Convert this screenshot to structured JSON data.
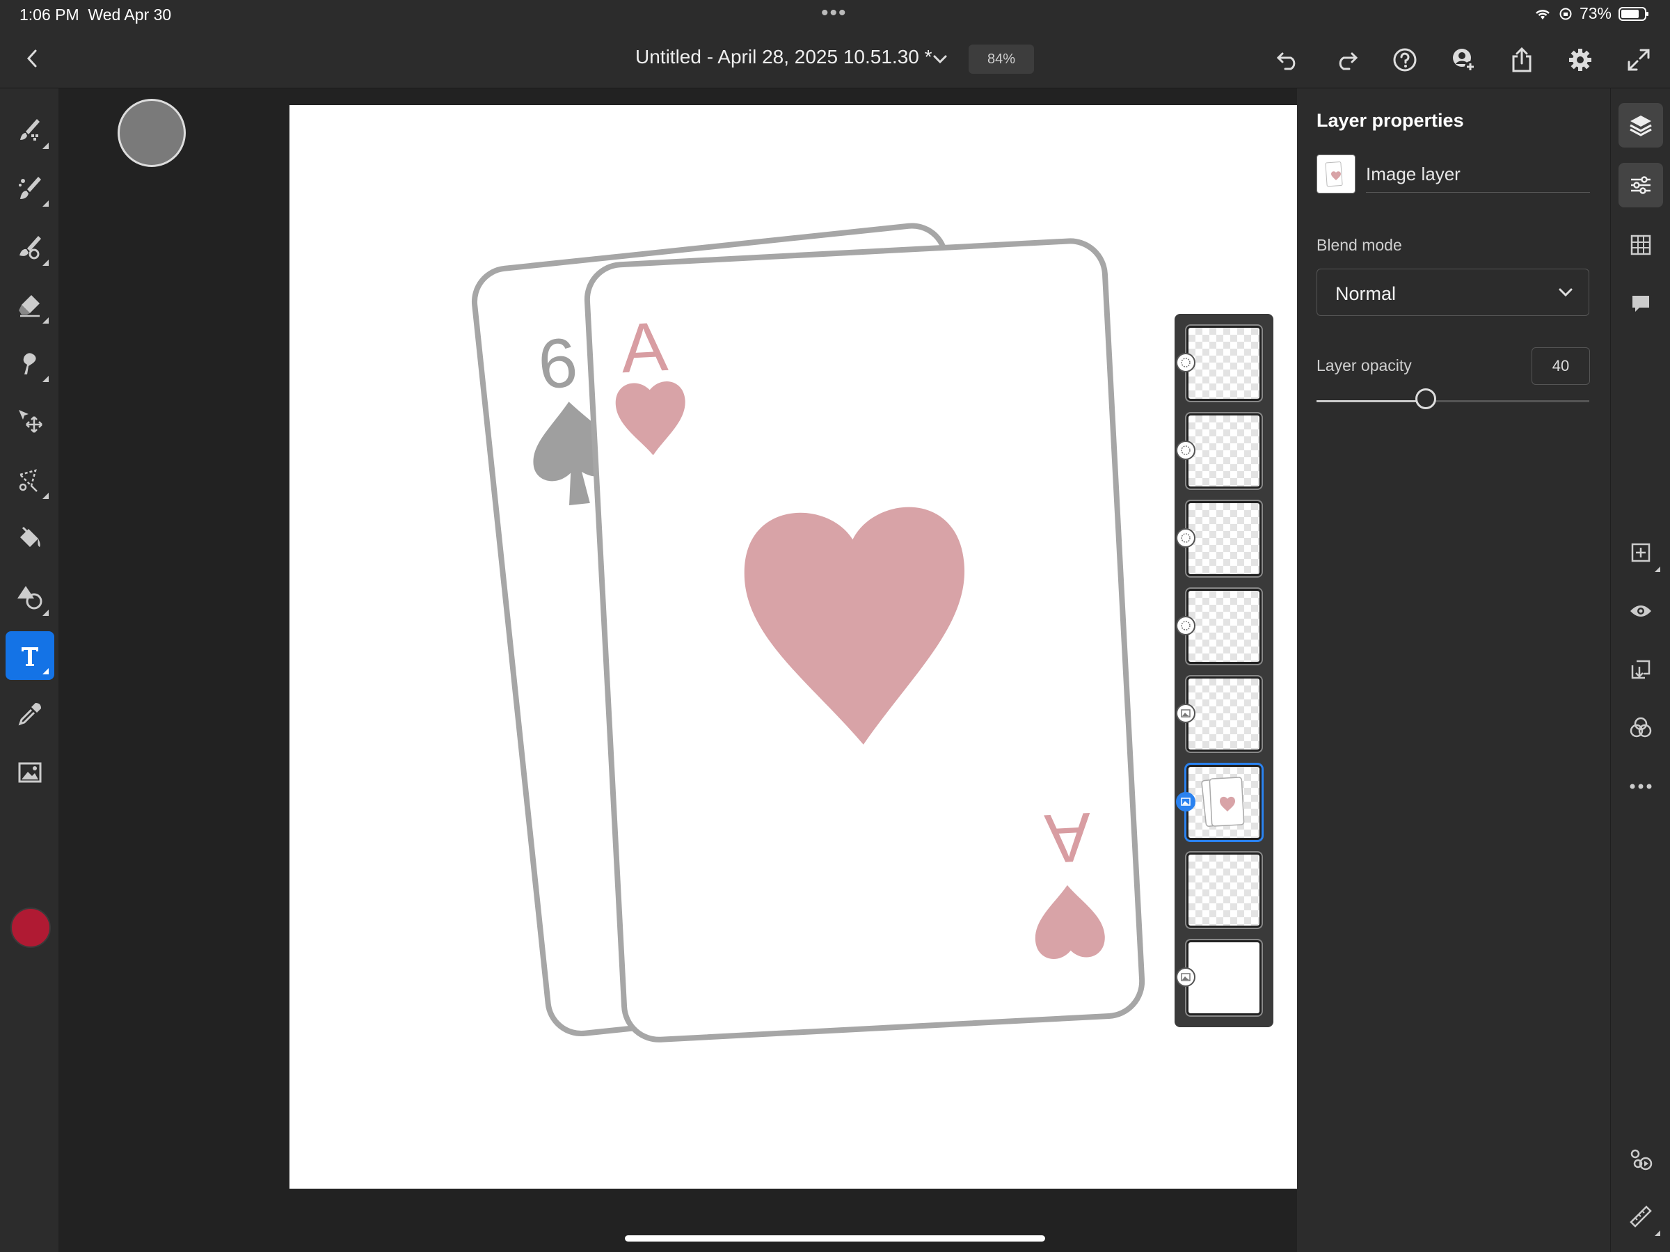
{
  "status": {
    "time": "1:06 PM",
    "date": "Wed Apr 30",
    "battery": "73%"
  },
  "header": {
    "doc_title": "Untitled - April 28, 2025 10.51.30 *",
    "zoom": "84%"
  },
  "canvas": {
    "back_card_rank": "6",
    "front_card_rank": "A",
    "front_card_rank_bottom": "A"
  },
  "properties": {
    "title": "Layer properties",
    "layer_name": "Image layer",
    "blend_label": "Blend mode",
    "blend_value": "Normal",
    "opacity_label": "Layer opacity",
    "opacity_value": "40",
    "opacity_fraction": 0.4
  },
  "colors": {
    "accent": "#1473e6",
    "foreground_color": "#b01a33",
    "heart": "#d8a3a7",
    "card_outline": "#a6a6a6"
  },
  "layers": [
    {
      "type": "adjustment",
      "selected": false
    },
    {
      "type": "adjustment",
      "selected": false
    },
    {
      "type": "adjustment",
      "selected": false
    },
    {
      "type": "adjustment",
      "selected": false
    },
    {
      "type": "image",
      "selected": false
    },
    {
      "type": "image",
      "selected": true
    },
    {
      "type": "adjustment",
      "selected": false
    },
    {
      "type": "image",
      "selected": false
    }
  ]
}
